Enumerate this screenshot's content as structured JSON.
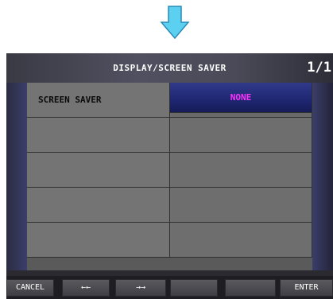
{
  "colors": {
    "arrow": "#5cd0f0",
    "value_text": "#ff33ff",
    "selected_cell": "#1e2670"
  },
  "icons": {
    "down_arrow": "down-arrow-icon"
  },
  "header": {
    "title": "DISPLAY/SCREEN SAVER",
    "page": "1/1"
  },
  "rows": [
    {
      "label": "SCREEN SAVER",
      "value": "NONE"
    },
    {
      "label": "",
      "value": ""
    },
    {
      "label": "",
      "value": ""
    },
    {
      "label": "",
      "value": ""
    },
    {
      "label": "",
      "value": ""
    }
  ],
  "footer": {
    "cancel": "CANCEL",
    "prev": "←←",
    "next": "→→",
    "blank1": "",
    "blank2": "",
    "enter": "ENTER"
  }
}
